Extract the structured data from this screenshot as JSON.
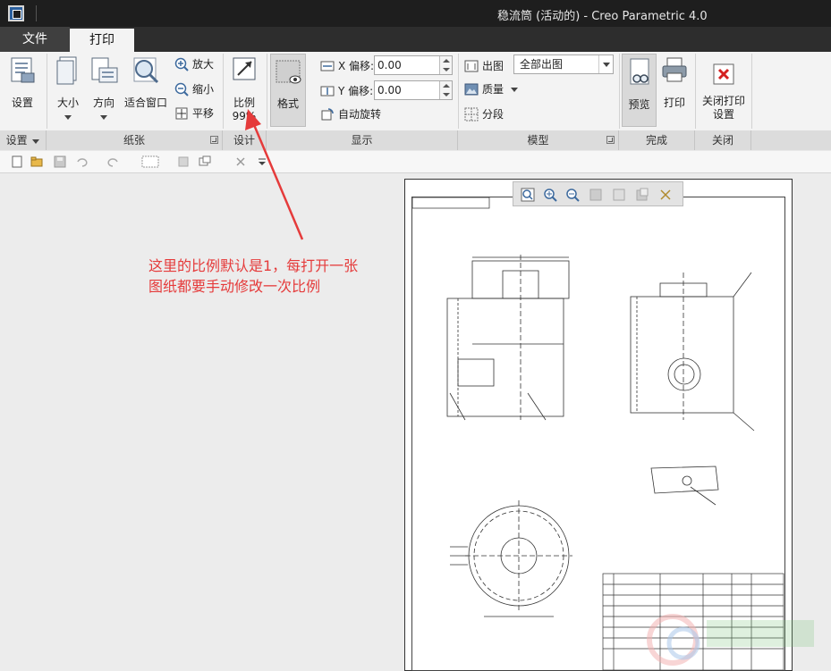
{
  "titlebar": {
    "title": "稳流筒 (活动的) - Creo Parametric 4.0"
  },
  "tabs": {
    "file": "文件",
    "print": "打印"
  },
  "ribbon": {
    "settings": {
      "button": "设置",
      "group": "设置"
    },
    "paper": {
      "size": "大小",
      "orientation": "方向",
      "fit_window": "适合窗口",
      "zoom_in": "放大",
      "zoom_out": "缩小",
      "pan": "平移",
      "group": "纸张"
    },
    "design": {
      "scale_label": "比例",
      "scale_value": "99%",
      "group": "设计"
    },
    "format": {
      "button": "格式"
    },
    "display": {
      "x_offset_label": "X 偏移:",
      "x_offset_value": "0.00",
      "y_offset_label": "Y 偏移:",
      "y_offset_value": "0.00",
      "auto_rotate": "自动旋转",
      "group": "显示"
    },
    "model": {
      "output": "出图",
      "output_select": "全部出图",
      "quality": "质量",
      "segment": "分段",
      "group": "模型"
    },
    "finish": {
      "preview": "预览",
      "print": "打印",
      "group": "完成"
    },
    "close": {
      "button_line1": "关闭打印",
      "button_line2": "设置",
      "group": "关闭"
    }
  },
  "annotation": {
    "line1": "这里的比例默认是1，每打开一张",
    "line2": "图纸都要手动修改一次比例"
  },
  "icons": {
    "app": "app-icon",
    "settings": "printer-settings-icon",
    "size": "paper-size-icon",
    "orientation": "orientation-icon",
    "fit": "magnifier-icon",
    "zoom_in": "zoom-in-icon",
    "zoom_out": "zoom-out-icon",
    "pan": "pan-icon",
    "scale": "scale-icon",
    "format": "format-icon",
    "preview": "preview-icon",
    "print": "printer-icon",
    "close": "close-icon"
  },
  "colors": {
    "annotation": "#e53b3b",
    "titlebar": "#1e1e1e",
    "ribbon": "#f3f3f3"
  }
}
